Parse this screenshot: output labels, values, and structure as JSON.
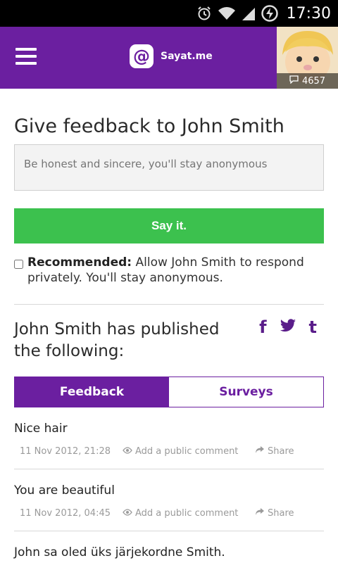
{
  "status_bar": {
    "time": "17:30"
  },
  "header": {
    "brand_logo": "@",
    "brand_name": "Sayat.me",
    "avatar_count": "4657"
  },
  "main": {
    "title": "Give feedback to John Smith",
    "input_placeholder": "Be honest and sincere, you'll stay anonymous",
    "submit_label": "Say it.",
    "recommended_label": "Recommended:",
    "recommended_text": " Allow John Smith to respond privately. You'll stay anonymous.",
    "published_title": "John Smith has published the following:",
    "share": {
      "facebook": "f",
      "twitter": "t",
      "tumblr": "t"
    },
    "tabs": [
      {
        "label": "Feedback",
        "active": true
      },
      {
        "label": "Surveys",
        "active": false
      }
    ],
    "feed": [
      {
        "text": "Nice hair",
        "date": "11 Nov 2012, 21:28",
        "comment": "Add a public comment",
        "share": "Share"
      },
      {
        "text": "You are beautiful",
        "date": "11 Nov 2012, 04:45",
        "comment": "Add a public comment",
        "share": "Share"
      },
      {
        "text": "John sa oled üks järjekordne Smith."
      }
    ]
  },
  "colors": {
    "brand": "#6b1fa0",
    "accent_green": "#3cc14e",
    "statusbar": "#000000"
  }
}
